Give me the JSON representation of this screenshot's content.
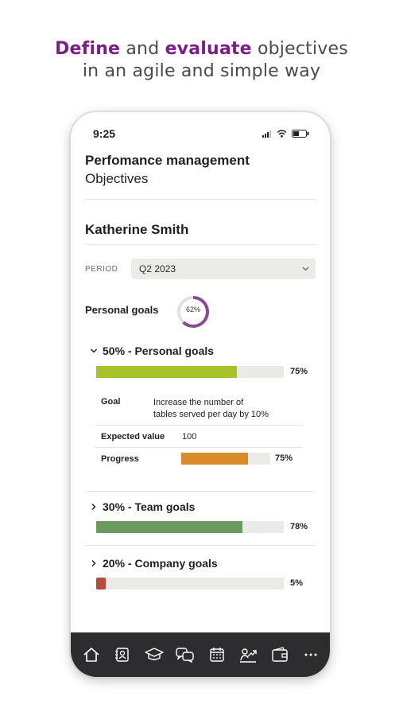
{
  "headline": {
    "w1": "Define",
    "w2": " and ",
    "w3": "evaluate",
    "w4": " objectives",
    "line2": "in an agile and simple way",
    "accent_color": "#7a1f86"
  },
  "status": {
    "time": "9:25"
  },
  "header": {
    "title": "Perfomance management",
    "subtitle": "Objectives"
  },
  "employee": {
    "name": "Katherine Smith"
  },
  "period": {
    "label": "PERIOD",
    "value": "Q2 2023"
  },
  "personal_goals": {
    "label": "Personal goals",
    "progress_text": "62%",
    "progress": 0.62,
    "ring_color": "#8a4a93"
  },
  "sections": [
    {
      "title": "50% - Personal goals",
      "pct_text": "75%",
      "progress": 0.75,
      "color": "#a6c42a",
      "expanded": true
    },
    {
      "title": "30% - Team goals",
      "pct_text": "78%",
      "progress": 0.78,
      "color": "#6a9a5c",
      "expanded": false
    },
    {
      "title": "20% - Company goals",
      "pct_text": "5%",
      "progress": 0.05,
      "color": "#b64a3f",
      "expanded": false
    }
  ],
  "goal_detail": {
    "goal_key": "Goal",
    "goal_line1": "Increase the number of",
    "goal_line2": "tables served per day by 10%",
    "expected_key": "Expected value",
    "expected_value": "100",
    "progress_key": "Progress",
    "progress_text": "75%",
    "progress": 0.75,
    "progress_color": "#d98a2b"
  },
  "nav": [
    "home-icon",
    "contacts-icon",
    "graduation-cap-icon",
    "chat-icon",
    "calendar-icon",
    "performance-icon",
    "wallet-icon",
    "more-icon"
  ]
}
